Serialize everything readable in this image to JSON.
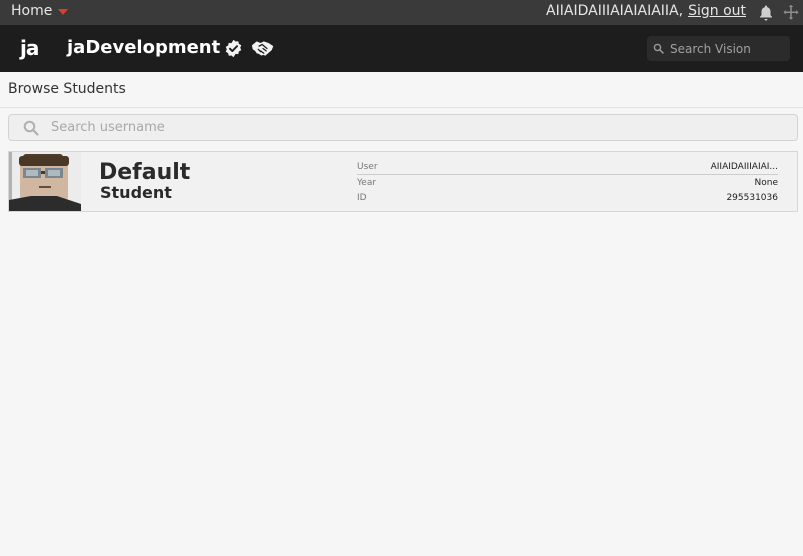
{
  "topbar": {
    "home_label": "Home",
    "username": "AIIAIDAIIIAIAIAIAIIA,",
    "signout_label": "Sign out"
  },
  "header": {
    "logo_text": "ja",
    "group_name": "jaDevelopment",
    "search_placeholder": "Search Vision"
  },
  "page": {
    "title": "Browse Students",
    "search_placeholder": "Search username"
  },
  "students": [
    {
      "first_name": "Default",
      "last_name": "Student",
      "fields": [
        {
          "label": "User",
          "value": "AIIAIDAIIIAIAI..."
        },
        {
          "label": "Year",
          "value": "None"
        },
        {
          "label": "ID",
          "value": "295531036"
        }
      ]
    }
  ],
  "colors": {
    "topbar_bg": "#3a3a3a",
    "header_bg": "#1d1d1d",
    "accent_caret": "#e23a2e",
    "page_bg": "#f6f6f6"
  }
}
